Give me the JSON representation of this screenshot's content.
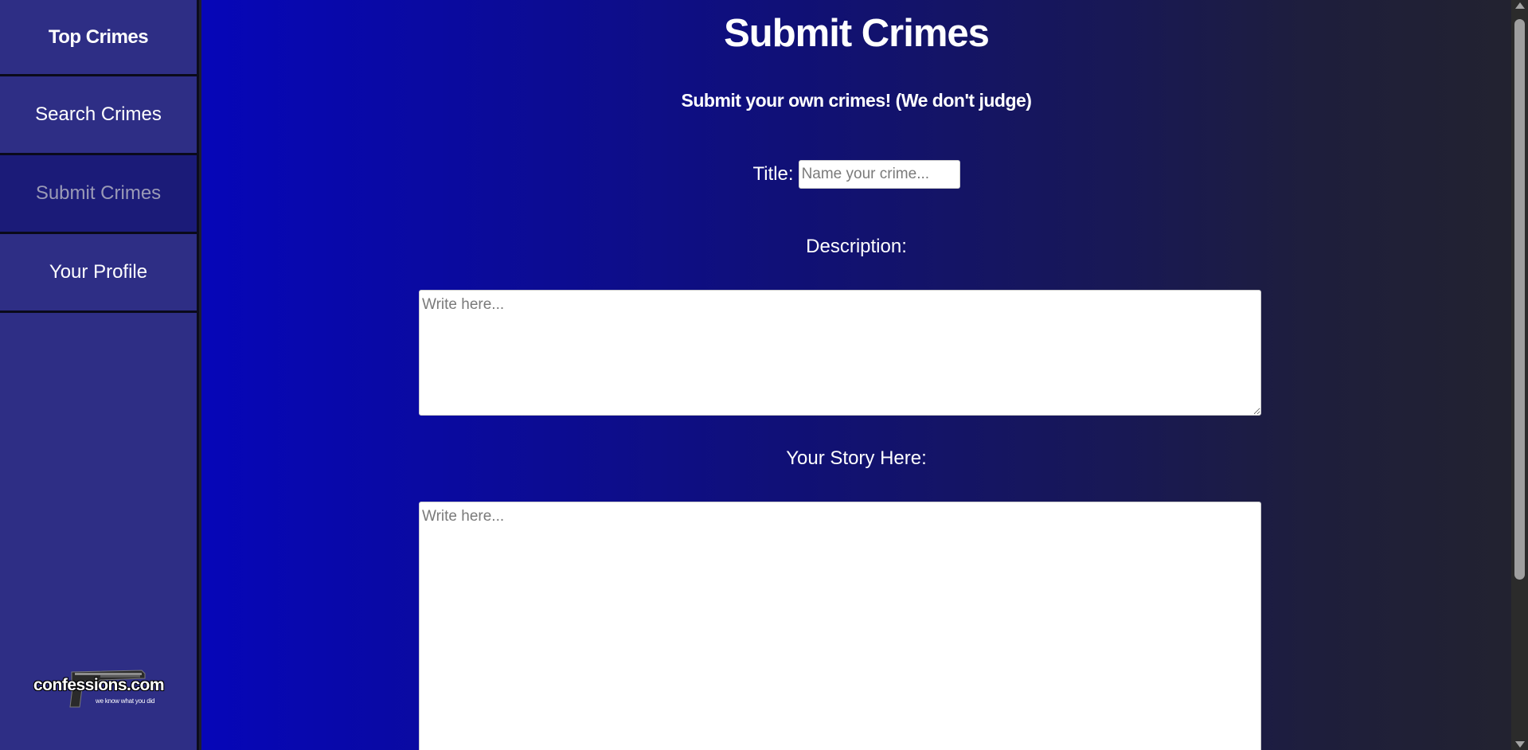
{
  "sidebar": {
    "items": [
      {
        "label": "Top Crimes"
      },
      {
        "label": "Search Crimes"
      },
      {
        "label": "Submit Crimes"
      },
      {
        "label": "Your Profile"
      }
    ],
    "active_index": 2,
    "logo": {
      "brand": "confessions.com",
      "tagline": "we know what you did"
    }
  },
  "main": {
    "title": "Submit Crimes",
    "subtitle": "Submit your own crimes! (We don't judge)",
    "title_field": {
      "label": "Title:",
      "placeholder": "Name your crime..."
    },
    "description_field": {
      "label": "Description:",
      "placeholder": "Write here..."
    },
    "story_field": {
      "label": "Your Story Here:",
      "placeholder": "Write here..."
    }
  },
  "colors": {
    "sidebar_bg": "#2e2e85",
    "active_bg": "#1b1b78",
    "gradient_start": "#0606b8",
    "gradient_end": "#222230"
  }
}
